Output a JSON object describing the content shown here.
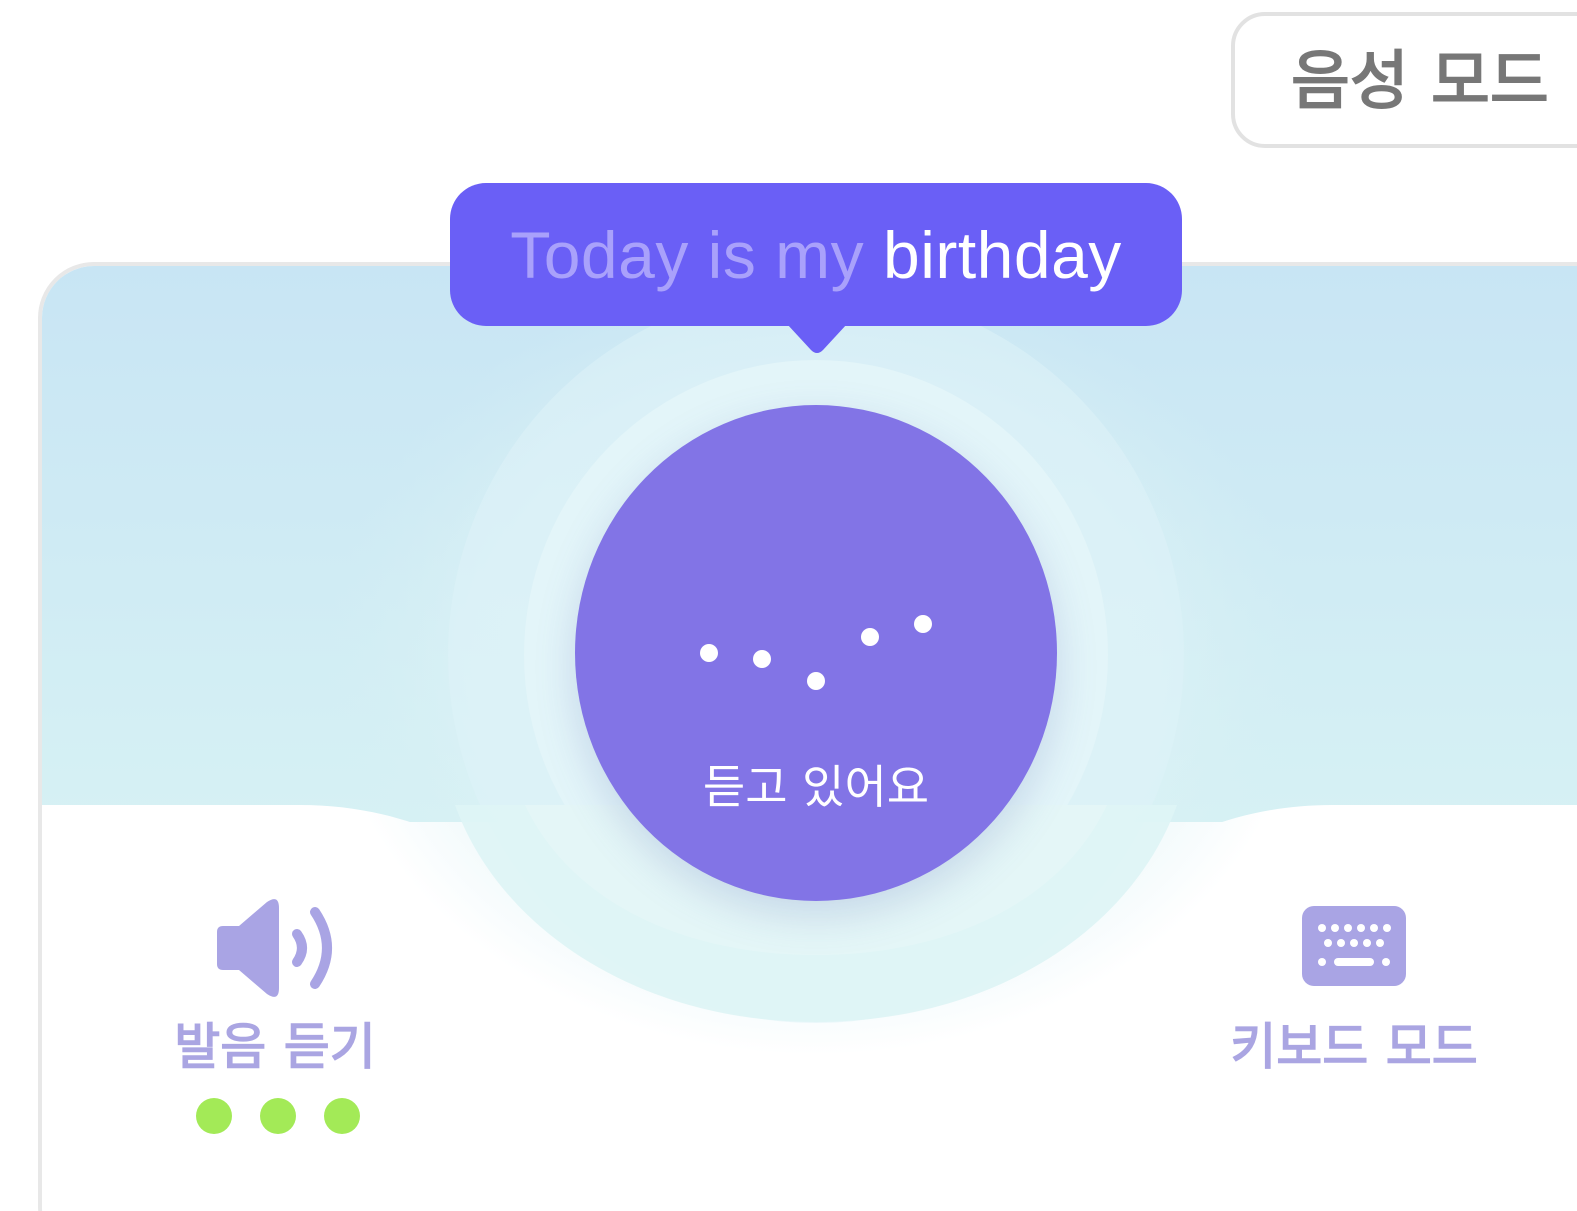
{
  "header": {
    "mode_label": "음성 모드"
  },
  "bubble": {
    "muted_text": "Today is my",
    "strong_text": "birthday"
  },
  "mic": {
    "status_label": "듣고 있어요"
  },
  "listen": {
    "label": "발음 듣기",
    "progress_steps": 3,
    "progress_done": 3
  },
  "keyboard": {
    "label": "키보드 모드"
  },
  "colors": {
    "accent": "#6a5ff6",
    "mic": "#8274e6",
    "icon": "#a9a4e4",
    "progress": "#a3ea57",
    "sky": "#c9e6f4"
  },
  "icons": {
    "speaker": "speaker-icon",
    "keyboard": "keyboard-icon"
  }
}
